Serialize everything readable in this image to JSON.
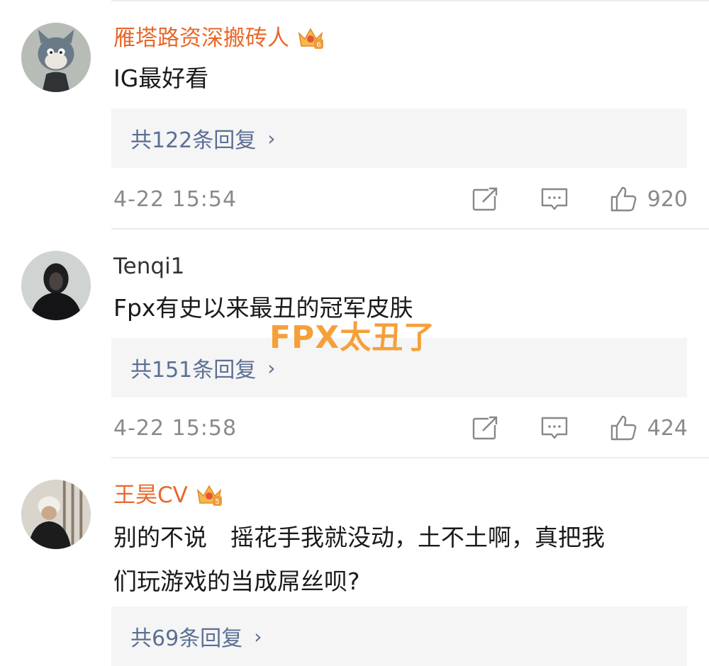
{
  "comments": [
    {
      "username": "雁塔路资深搬砖人",
      "vip_level": "6",
      "text": "IG最好看",
      "reply_label": "共122条回复",
      "timestamp": "4-22 15:54",
      "likes": "920"
    },
    {
      "username": "Tenqi1",
      "text": "Fpx有史以来最丑的冠军皮肤",
      "reply_label": "共151条回复",
      "timestamp": "4-22 15:58",
      "likes": "424"
    },
    {
      "username": "王昊CV",
      "vip_level": "5",
      "text_line1": "别的不说　摇花手我就没动，土不土啊，真把我",
      "text_line2": "们玩游戏的当成屌丝呗?",
      "reply_label": "共69条回复"
    }
  ],
  "overlay_caption": "FPX太丑了",
  "icons": {
    "reply_chevron": "›",
    "share": "share-icon",
    "comment": "comment-icon",
    "like": "thumbs-up-icon"
  },
  "colors": {
    "vip_name": "#e8682a",
    "reply_link": "#5b6f94",
    "meta_gray": "#8a8a8a",
    "overlay": "#f5a03a",
    "reply_bg": "#f5f5f5"
  }
}
